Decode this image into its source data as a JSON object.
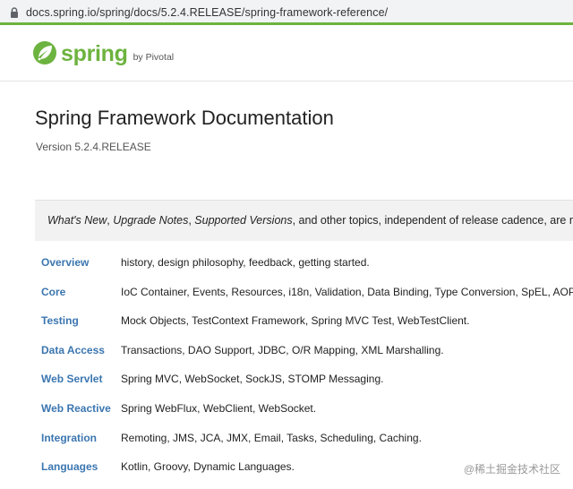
{
  "browser": {
    "url": "docs.spring.io/spring/docs/5.2.4.RELEASE/spring-framework-reference/"
  },
  "header": {
    "logo_word": "spring",
    "logo_by": "by Pivotal",
    "brand_color": "#6db33f"
  },
  "main": {
    "title": "Spring Framework Documentation",
    "version": "Version 5.2.4.RELEASE",
    "note": {
      "link1": "What's New",
      "sep1": ", ",
      "link2": "Upgrade Notes",
      "sep2": ", ",
      "link3": "Supported Versions",
      "rest": ", and other topics, independent of release cadence, are maintai"
    },
    "sections": [
      {
        "label": "Overview",
        "desc": "history, design philosophy, feedback, getting started."
      },
      {
        "label": "Core",
        "desc": "IoC Container, Events, Resources, i18n, Validation, Data Binding, Type Conversion, SpEL, AOP."
      },
      {
        "label": "Testing",
        "desc": "Mock Objects, TestContext Framework, Spring MVC Test, WebTestClient."
      },
      {
        "label": "Data Access",
        "desc": "Transactions, DAO Support, JDBC, O/R Mapping, XML Marshalling."
      },
      {
        "label": "Web Servlet",
        "desc": "Spring MVC, WebSocket, SockJS, STOMP Messaging."
      },
      {
        "label": "Web Reactive",
        "desc": "Spring WebFlux, WebClient, WebSocket."
      },
      {
        "label": "Integration",
        "desc": "Remoting, JMS, JCA, JMX, Email, Tasks, Scheduling, Caching."
      },
      {
        "label": "Languages",
        "desc": "Kotlin, Groovy, Dynamic Languages."
      }
    ]
  },
  "watermark": "@稀土掘金技术社区",
  "colors": {
    "link": "#3b76b0",
    "note_bg": "#f2f2f2"
  }
}
